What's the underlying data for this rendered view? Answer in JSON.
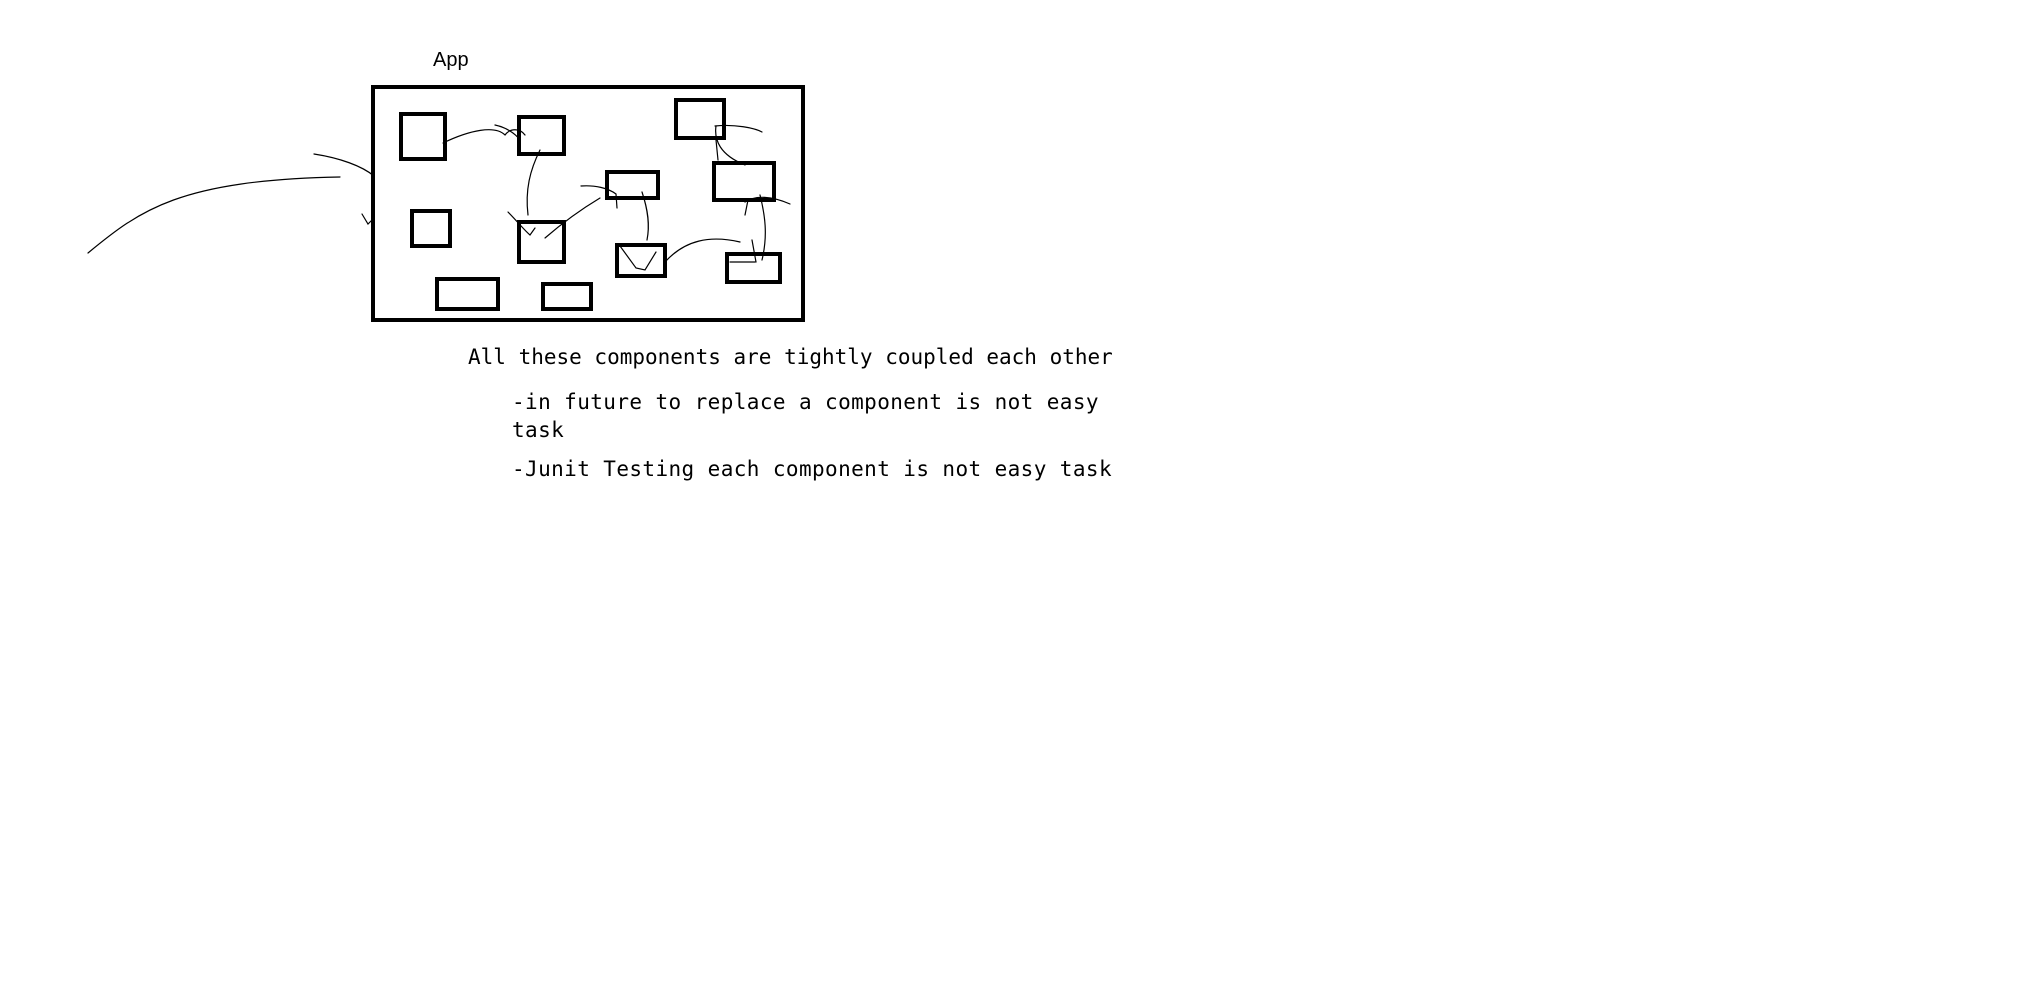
{
  "diagram": {
    "container_label": "App",
    "stroke_color": "#000000",
    "background_color": "#ffffff"
  },
  "notes": {
    "heading": "All these components are tightly coupled each other",
    "items": [
      "-in future to replace a component is not easy task",
      "-Junit Testing each component is not easy task"
    ]
  }
}
